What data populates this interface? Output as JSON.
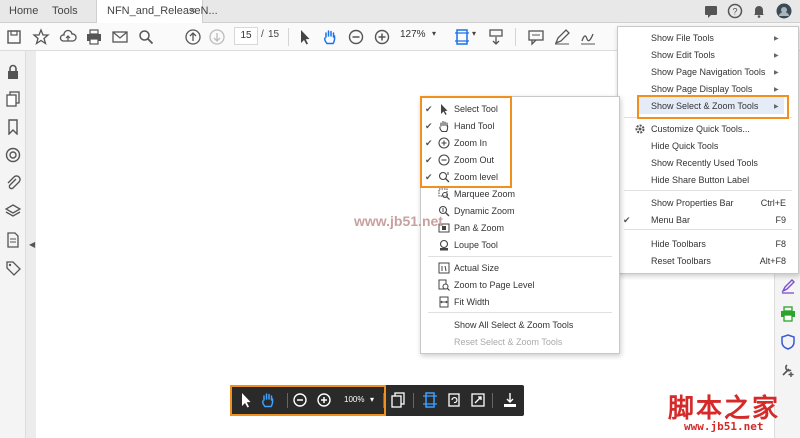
{
  "tabs": {
    "home": "Home",
    "tools": "Tools",
    "document": "NFN_and_ReleaseN...",
    "close": "×"
  },
  "toolbar": {
    "page_current": "15",
    "page_sep": "/",
    "page_total": "15",
    "zoom": "127%"
  },
  "main_menu": {
    "items": [
      {
        "label": "Show File Tools",
        "submenu": true
      },
      {
        "label": "Show Edit Tools",
        "submenu": true
      },
      {
        "label": "Show Page Navigation Tools",
        "submenu": true
      },
      {
        "label": "Show Page Display Tools",
        "submenu": true
      },
      {
        "label": "Show Select & Zoom Tools",
        "submenu": true,
        "highlighted": true
      },
      {
        "label": "Customize Quick Tools..."
      },
      {
        "label": "Hide Quick Tools"
      },
      {
        "label": "Show Recently Used Tools"
      },
      {
        "label": "Hide Share Button Label"
      },
      {
        "label": "Show Properties Bar",
        "shortcut": "Ctrl+E"
      },
      {
        "label": "Menu Bar",
        "shortcut": "F9",
        "checked": true
      },
      {
        "label": "Hide Toolbars",
        "shortcut": "F8"
      },
      {
        "label": "Reset Toolbars",
        "shortcut": "Alt+F8"
      }
    ]
  },
  "sub_menu": {
    "items": [
      {
        "label": "Select Tool",
        "checked": true,
        "icon": "cursor-icon"
      },
      {
        "label": "Hand Tool",
        "checked": true,
        "icon": "hand-icon"
      },
      {
        "label": "Zoom In",
        "checked": true,
        "icon": "zoom-in-icon"
      },
      {
        "label": "Zoom Out",
        "checked": true,
        "icon": "zoom-out-icon"
      },
      {
        "label": "Zoom level",
        "checked": true,
        "icon": "zoom-level-icon"
      },
      {
        "label": "Marquee Zoom",
        "icon": "marquee-zoom-icon"
      },
      {
        "label": "Dynamic Zoom",
        "icon": "dynamic-zoom-icon"
      },
      {
        "label": "Pan & Zoom",
        "icon": "pan-zoom-icon"
      },
      {
        "label": "Loupe Tool",
        "icon": "loupe-icon"
      },
      {
        "label": "Actual Size",
        "icon": "actual-size-icon"
      },
      {
        "label": "Zoom to Page Level",
        "icon": "zoom-page-icon"
      },
      {
        "label": "Fit Width",
        "icon": "fit-width-icon"
      },
      {
        "label": "Show All Select & Zoom Tools"
      },
      {
        "label": "Reset Select & Zoom Tools",
        "disabled": true
      }
    ]
  },
  "floating_toolbar": {
    "zoom": "100%"
  },
  "watermarks": {
    "left": "www.jb51.net",
    "logo": "脚本之家",
    "url": "www.jb51.net"
  },
  "colors": {
    "highlight": "#f0901e",
    "accent": "#1a73e8",
    "purple": "#7a4ed0",
    "green": "#2aa52a"
  }
}
